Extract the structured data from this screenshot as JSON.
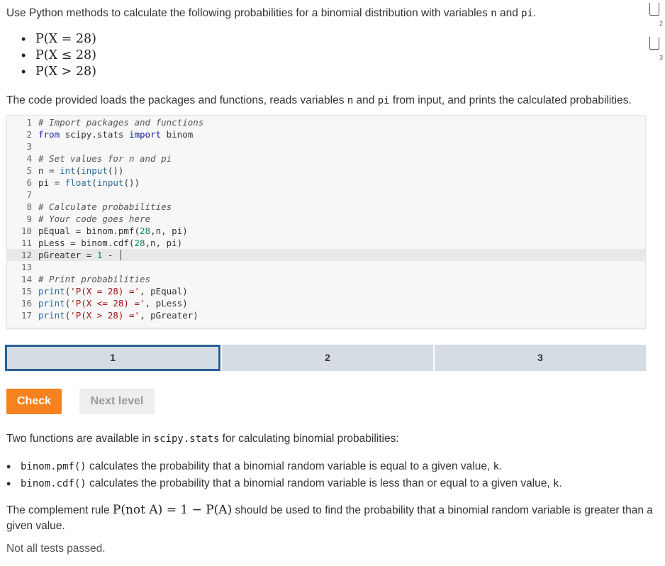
{
  "instructions": {
    "text_before": "Use Python methods to calculate the following probabilities for a binomial distribution with variables ",
    "var_n": "n",
    "text_and": " and ",
    "var_pi": "pi",
    "text_end": "."
  },
  "probabilities": [
    "P(X = 28)",
    "P(X ≤ 28)",
    "P(X > 28)"
  ],
  "description": {
    "text1": "The code provided loads the packages and functions, reads variables ",
    "var_n": "n",
    "text2": " and ",
    "var_pi": "pi",
    "text3": " from input, and prints the calculated probabilities."
  },
  "editor": {
    "lines": [
      {
        "n": "1",
        "code": "# Import packages and functions"
      },
      {
        "n": "2",
        "code": "from scipy.stats import binom"
      },
      {
        "n": "3",
        "code": ""
      },
      {
        "n": "4",
        "code": "# Set values for n and pi"
      },
      {
        "n": "5",
        "code": "n = int(input())"
      },
      {
        "n": "6",
        "code": "pi = float(input())"
      },
      {
        "n": "7",
        "code": ""
      },
      {
        "n": "8",
        "code": "# Calculate probabilities"
      },
      {
        "n": "9",
        "code": "# Your code goes here"
      },
      {
        "n": "10",
        "code": "pEqual = binom.pmf(28,n, pi)"
      },
      {
        "n": "11",
        "code": "pLess = binom.cdf(28,n, pi)"
      },
      {
        "n": "12",
        "code": "pGreater = 1 - "
      },
      {
        "n": "13",
        "code": ""
      },
      {
        "n": "14",
        "code": "# Print probabilities"
      },
      {
        "n": "15",
        "code": "print('P(X = 28) =', pEqual)"
      },
      {
        "n": "16",
        "code": "print('P(X <= 28) =', pLess)"
      },
      {
        "n": "17",
        "code": "print('P(X > 28) =', pGreater)"
      }
    ],
    "active_line": 12
  },
  "levels": [
    {
      "label": "1",
      "current": true
    },
    {
      "label": "2",
      "current": false
    },
    {
      "label": "3",
      "current": false
    }
  ],
  "buttons": {
    "check": "Check",
    "next": "Next level"
  },
  "feedback": {
    "intro_text": "Two functions are available in ",
    "intro_code": "scipy.stats",
    "intro_end": " for calculating binomial probabilities:",
    "bullets": [
      {
        "code": "binom.pmf()",
        "text": " calculates the probability that a binomial random variable is equal to a given value, ",
        "var": "k",
        "end": "."
      },
      {
        "code": "binom.cdf()",
        "text": " calculates the probability that a binomial random variable is less than or equal to a given value, ",
        "var": "k",
        "end": "."
      }
    ],
    "complement_before": "The complement rule ",
    "complement_math": "P(not A) = 1 − P(A)",
    "complement_after": " should be used to find the probability that a binomial random variable is greater than a given value.",
    "status": "Not all tests passed."
  },
  "side_icons": [
    {
      "label": "2"
    },
    {
      "label": "3"
    }
  ],
  "colors": {
    "accent": "#f5821f",
    "level_border": "#2b5f94",
    "level_bg": "#d5dce3"
  }
}
